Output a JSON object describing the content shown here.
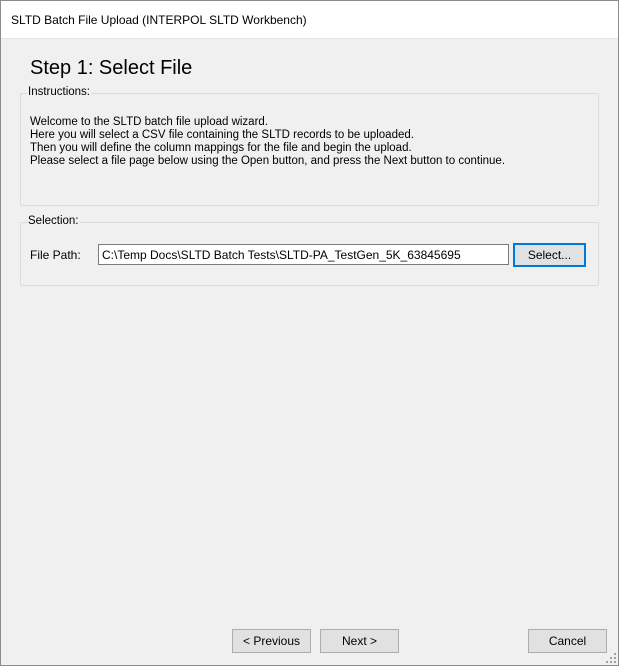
{
  "window": {
    "title": "SLTD Batch File Upload (INTERPOL SLTD Workbench)"
  },
  "step": {
    "title": "Step 1:  Select File"
  },
  "instructions": {
    "group_label": "Instructions:",
    "lines": [
      "Welcome to the SLTD batch file upload wizard.",
      "Here you will select a CSV file containing the SLTD records to be uploaded.",
      "Then you will define the column mappings for the file and begin the upload.",
      "Please select a file page below using the Open button, and press the Next button to continue."
    ]
  },
  "selection": {
    "group_label": "Selection:",
    "file_path_label": "File Path:",
    "file_path_value": "C:\\Temp Docs\\SLTD Batch Tests\\SLTD-PA_TestGen_5K_63845695",
    "select_button": "Select..."
  },
  "footer": {
    "previous_button": "< Previous",
    "next_button": "Next >",
    "cancel_button": "Cancel"
  }
}
